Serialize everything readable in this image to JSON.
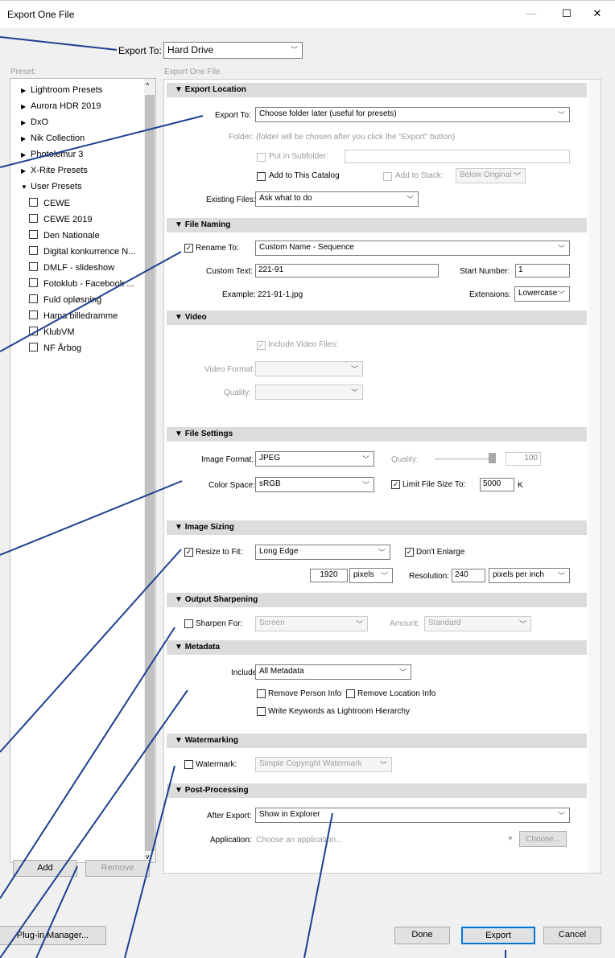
{
  "window": {
    "title": "Export One File",
    "minimize": "—",
    "maximize": "☐",
    "close": "✕"
  },
  "top": {
    "export_to_label": "Export To:",
    "export_to_value": "Hard Drive"
  },
  "preset_panel": {
    "label": "Preset:",
    "items": [
      {
        "label": "Lightroom Presets"
      },
      {
        "label": "Aurora HDR 2019"
      },
      {
        "label": "DxO"
      },
      {
        "label": "Nik Collection"
      },
      {
        "label": "Photolemur 3"
      },
      {
        "label": "X-Rite Presets"
      },
      {
        "label": "User Presets"
      },
      {
        "label": "CEWE"
      },
      {
        "label": "CEWE 2019"
      },
      {
        "label": "Den Nationale"
      },
      {
        "label": "Digital konkurrence N..."
      },
      {
        "label": "DMLF - slideshow"
      },
      {
        "label": "Fotoklub - Facebook ..."
      },
      {
        "label": "Fuld opløsning"
      },
      {
        "label": "Hama billedramme"
      },
      {
        "label": "KlubVM"
      },
      {
        "label": "NF Årbog"
      }
    ],
    "add": "Add",
    "remove": "Remove"
  },
  "main_label": "Export One File",
  "export_location": {
    "header": "Export Location",
    "export_to_label": "Export To:",
    "export_to_value": "Choose folder later (useful for presets)",
    "folder_label": "Folder:",
    "folder_text": "(folder will be chosen after you click the \"Export\" button)",
    "subfolder_label": "Put in Subfolder:",
    "add_catalog": "Add to This Catalog",
    "add_stack": "Add to Stack:",
    "stack_value": "Below Original",
    "existing_label": "Existing Files:",
    "existing_value": "Ask what to do"
  },
  "file_naming": {
    "header": "File Naming",
    "rename_label": "Rename To:",
    "rename_value": "Custom Name - Sequence",
    "custom_text_label": "Custom Text:",
    "custom_text_value": "221-91",
    "start_number_label": "Start Number:",
    "start_number_value": "1",
    "example_label": "Example:",
    "example_value": "221-91-1.jpg",
    "extensions_label": "Extensions:",
    "extensions_value": "Lowercase"
  },
  "video": {
    "header": "Video",
    "include": "Include Video Files:",
    "format_label": "Video Format:",
    "quality_label": "Quality:"
  },
  "file_settings": {
    "header": "File Settings",
    "format_label": "Image Format:",
    "format_value": "JPEG",
    "quality_label": "Quality:",
    "quality_value": "100",
    "quality_level": 1.0,
    "color_label": "Color Space:",
    "color_value": "sRGB",
    "limit_label": "Limit File Size To:",
    "limit_value": "5000",
    "limit_unit": "K"
  },
  "image_sizing": {
    "header": "Image Sizing",
    "resize_label": "Resize to Fit:",
    "resize_value": "Long Edge",
    "dont_enlarge": "Don't Enlarge",
    "size_value": "1920",
    "size_unit": "pixels",
    "resolution_label": "Resolution:",
    "resolution_value": "240",
    "resolution_unit": "pixels per inch"
  },
  "output_sharpening": {
    "header": "Output Sharpening",
    "sharpen_label": "Sharpen For:",
    "sharpen_value": "Screen",
    "amount_label": "Amount:",
    "amount_value": "Standard"
  },
  "metadata": {
    "header": "Metadata",
    "include_label": "Include:",
    "include_value": "All Metadata",
    "remove_person": "Remove Person Info",
    "remove_location": "Remove Location Info",
    "write_keywords": "Write Keywords as Lightroom Hierarchy"
  },
  "watermarking": {
    "header": "Watermarking",
    "watermark_label": "Watermark:",
    "watermark_value": "Simple Copyright Watermark"
  },
  "post_processing": {
    "header": "Post-Processing",
    "after_label": "After Export:",
    "after_value": "Show in Explorer",
    "app_label": "Application:",
    "app_placeholder": "Choose an application...",
    "choose": "Choose..."
  },
  "footer": {
    "plugin_manager": "Plug-in Manager...",
    "done": "Done",
    "export": "Export",
    "cancel": "Cancel"
  },
  "colors": {
    "annotation": "#1f3f8f",
    "accent": "#0078d7"
  }
}
